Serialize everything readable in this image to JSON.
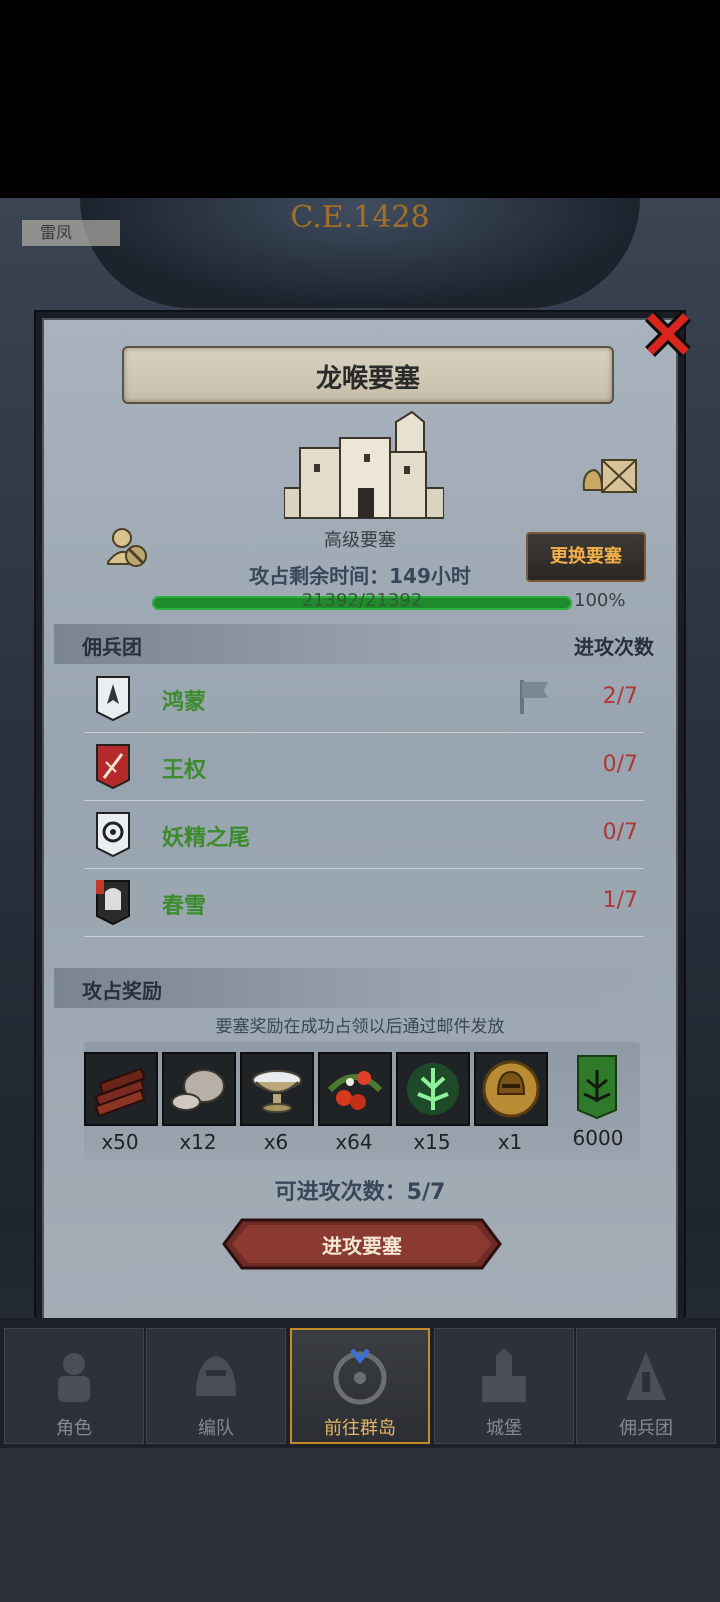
{
  "background": {
    "era_label": "C.E.1428",
    "left_tag": "雷凤"
  },
  "dialog": {
    "title": "龙喉要塞",
    "fortress_type": "高级要塞",
    "remaining_time": "攻占剩余时间：149小时",
    "change_button": "更换要塞",
    "hp": {
      "text": "21392/21392",
      "fraction": 1.0,
      "percent_label": "100%"
    },
    "mercenary_section": {
      "label": "佣兵团",
      "right_label": "进攻次数"
    },
    "mercenaries": [
      {
        "name": "鸿蒙",
        "attacks": "2/7",
        "icon": "crest-white-shield-icon"
      },
      {
        "name": "王权",
        "attacks": "0/7",
        "icon": "crest-red-sword-icon"
      },
      {
        "name": "妖精之尾",
        "attacks": "0/7",
        "icon": "crest-eye-swirl-icon"
      },
      {
        "name": "春雪",
        "attacks": "1/7",
        "icon": "crest-knight-helmet-icon"
      }
    ],
    "reward_section": {
      "label": "攻占奖励"
    },
    "reward_notice": "要塞奖励在成功占领以后通过邮件发放",
    "rewards": [
      {
        "name": "wood-icon",
        "qty": "x50"
      },
      {
        "name": "ore-icon",
        "qty": "x12"
      },
      {
        "name": "chalice-icon",
        "qty": "x6"
      },
      {
        "name": "berries-icon",
        "qty": "x64"
      },
      {
        "name": "green-crystal-icon",
        "qty": "x15"
      },
      {
        "name": "gold-helmet-medal-icon",
        "qty": "x1"
      },
      {
        "name": "guild-banner-icon",
        "qty": "6000"
      }
    ],
    "attempts_label": "可进攻次数：5/7",
    "attack_button": "进攻要塞"
  },
  "nav": {
    "items": [
      {
        "label": "角色",
        "icon": "character-icon",
        "active": false
      },
      {
        "label": "编队",
        "icon": "formation-icon",
        "active": false
      },
      {
        "label": "前往群岛",
        "icon": "compass-icon",
        "active": true
      },
      {
        "label": "城堡",
        "icon": "castle-icon",
        "active": false
      },
      {
        "label": "佣兵团",
        "icon": "mercenary-icon",
        "active": false
      }
    ]
  },
  "colors": {
    "accent_orange": "#f2b04a",
    "name_green": "#3c8c2e",
    "count_red": "#b03636",
    "hp_green": "#1e8a2b"
  }
}
